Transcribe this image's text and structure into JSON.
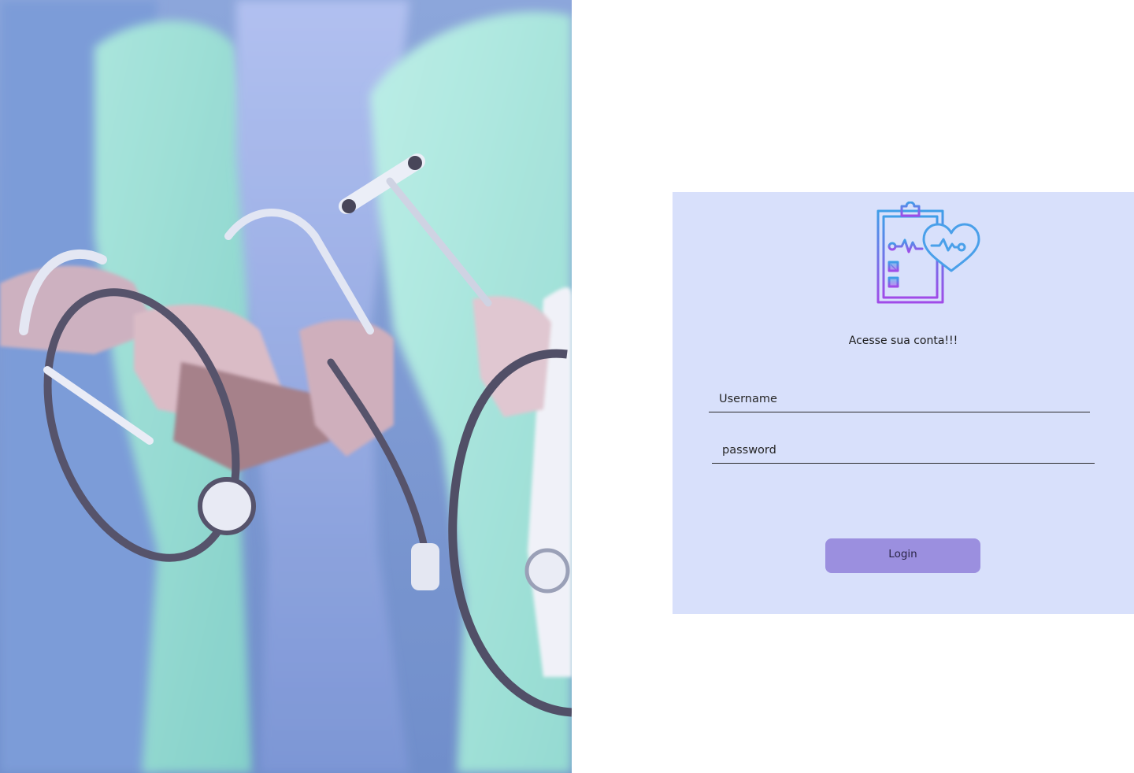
{
  "hero": {
    "image": "medical-team-stethoscopes-image"
  },
  "login": {
    "logo_icon": "medical-clipboard-heart-icon",
    "heading": "Acesse sua conta!!!",
    "username_placeholder": "Username",
    "username_value": "",
    "password_placeholder": "password",
    "password_value": "",
    "button_label": "Login"
  },
  "colors": {
    "card_background": "#d8e0fb",
    "button_background": "#9b8fdf",
    "logo_gradient_top": "#3f9ee8",
    "logo_gradient_bottom": "#a04be8"
  }
}
